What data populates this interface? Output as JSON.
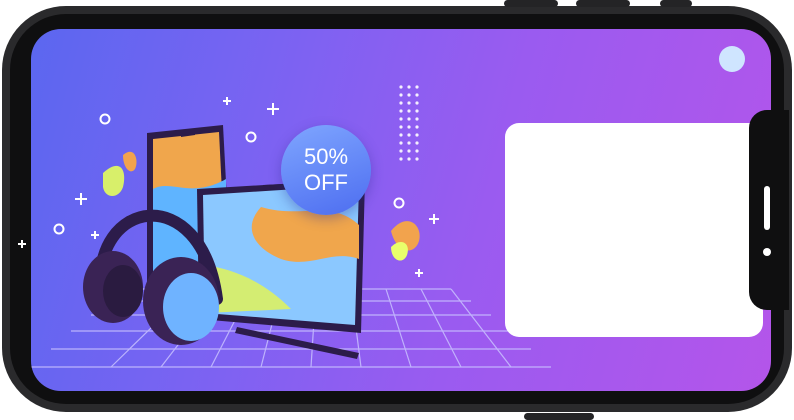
{
  "promo": {
    "discount_line1": "50%",
    "discount_line2": "OFF"
  },
  "colors": {
    "screen_gradient_start": "#5b67f0",
    "screen_gradient_end": "#b455ea",
    "badge": "#5b7cf3",
    "frame": "#2a2a2c"
  },
  "icons": [
    "headphones-icon",
    "smartphone-icon",
    "tablet-icon",
    "stylus-icon",
    "camera-dot"
  ]
}
